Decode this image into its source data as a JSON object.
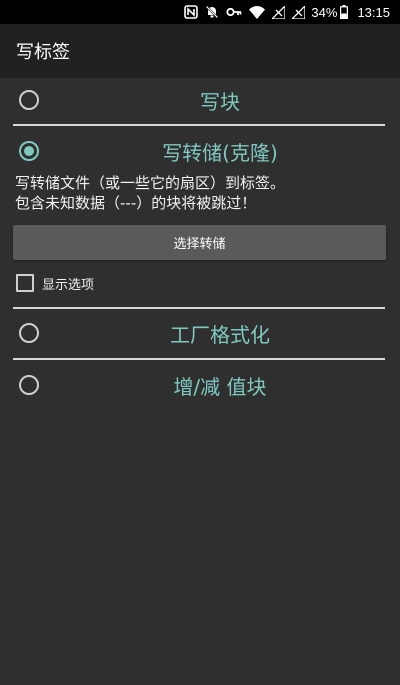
{
  "status_bar": {
    "battery": "34%",
    "time": "13:15",
    "icons": [
      "nfc-icon",
      "bell-off-icon",
      "key-icon",
      "wifi-icon",
      "signal-off-icon",
      "signal-off-icon",
      "battery-icon"
    ]
  },
  "app_bar": {
    "title": "写标签"
  },
  "options": {
    "write_block": "写块",
    "write_dump": "写转储(克隆)",
    "factory_format": "工厂格式化",
    "value_block": "增/减 值块"
  },
  "dump": {
    "desc_line1": "写转储文件（或一些它的扇区）到标签。",
    "desc_line2": "包含未知数据（---）的块将被跳过！",
    "select_button": "选择转储",
    "show_options": "显示选项"
  },
  "colors": {
    "accent": "#7fc9c1",
    "background": "#2f2f2f",
    "app_bar": "#212121",
    "button": "#5a5a5a"
  }
}
